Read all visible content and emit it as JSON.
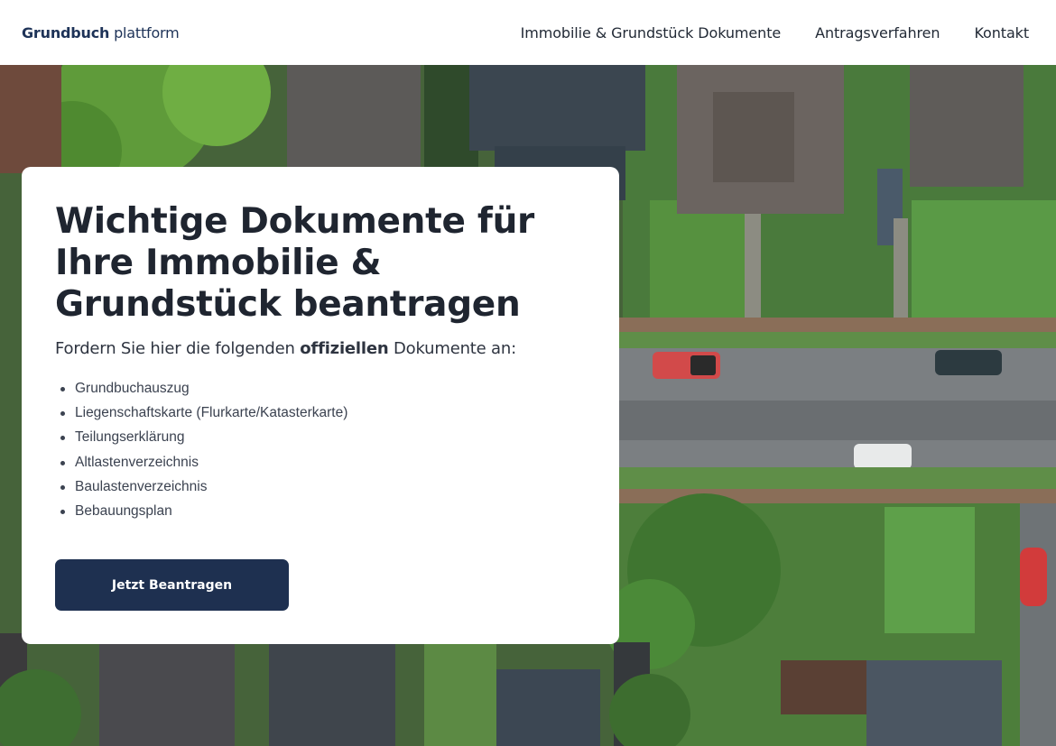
{
  "header": {
    "logo_bold": "Grundbuch",
    "logo_light": "plattform",
    "nav": [
      {
        "label": "Immobilie & Grundstück Dokumente"
      },
      {
        "label": "Antragsverfahren"
      },
      {
        "label": "Kontakt"
      }
    ]
  },
  "hero": {
    "title": "Wichtige Dokumente für Ihre Immobilie & Grundstück beantragen",
    "subtitle_pre": "Fordern Sie hier die folgenden ",
    "subtitle_bold": "offiziellen",
    "subtitle_post": " Dokumente an:",
    "documents": [
      "Grundbuchauszug",
      "Liegenschaftskarte (Flurkarte/Katasterkarte)",
      "Teilungserklärung",
      "Altlastenverzeichnis",
      "Baulastenverzeichnis",
      "Bebauungsplan"
    ],
    "cta_label": "Jetzt Beantragen"
  },
  "colors": {
    "brand": "#1e3358",
    "button": "#1e3050",
    "text": "#1f2530"
  }
}
